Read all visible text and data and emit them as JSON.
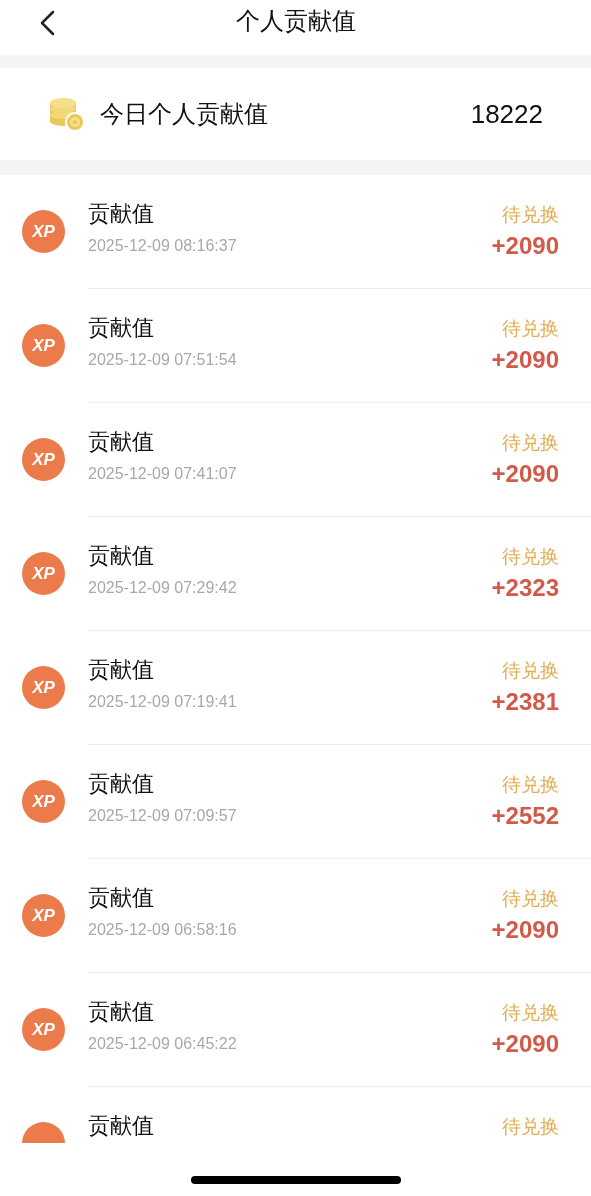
{
  "header": {
    "title": "个人贡献值"
  },
  "summary": {
    "label": "今日个人贡献值",
    "value": "18222"
  },
  "records": [
    {
      "badge": "XP",
      "title": "贡献值",
      "time": "2025-12-09 08:16:37",
      "status": "待兑换",
      "amount": "+2090"
    },
    {
      "badge": "XP",
      "title": "贡献值",
      "time": "2025-12-09 07:51:54",
      "status": "待兑换",
      "amount": "+2090"
    },
    {
      "badge": "XP",
      "title": "贡献值",
      "time": "2025-12-09 07:41:07",
      "status": "待兑换",
      "amount": "+2090"
    },
    {
      "badge": "XP",
      "title": "贡献值",
      "time": "2025-12-09 07:29:42",
      "status": "待兑换",
      "amount": "+2323"
    },
    {
      "badge": "XP",
      "title": "贡献值",
      "time": "2025-12-09 07:19:41",
      "status": "待兑换",
      "amount": "+2381"
    },
    {
      "badge": "XP",
      "title": "贡献值",
      "time": "2025-12-09 07:09:57",
      "status": "待兑换",
      "amount": "+2552"
    },
    {
      "badge": "XP",
      "title": "贡献值",
      "time": "2025-12-09 06:58:16",
      "status": "待兑换",
      "amount": "+2090"
    },
    {
      "badge": "XP",
      "title": "贡献值",
      "time": "2025-12-09 06:45:22",
      "status": "待兑换",
      "amount": "+2090"
    },
    {
      "title": "贡献值",
      "status": "待兑换"
    }
  ]
}
